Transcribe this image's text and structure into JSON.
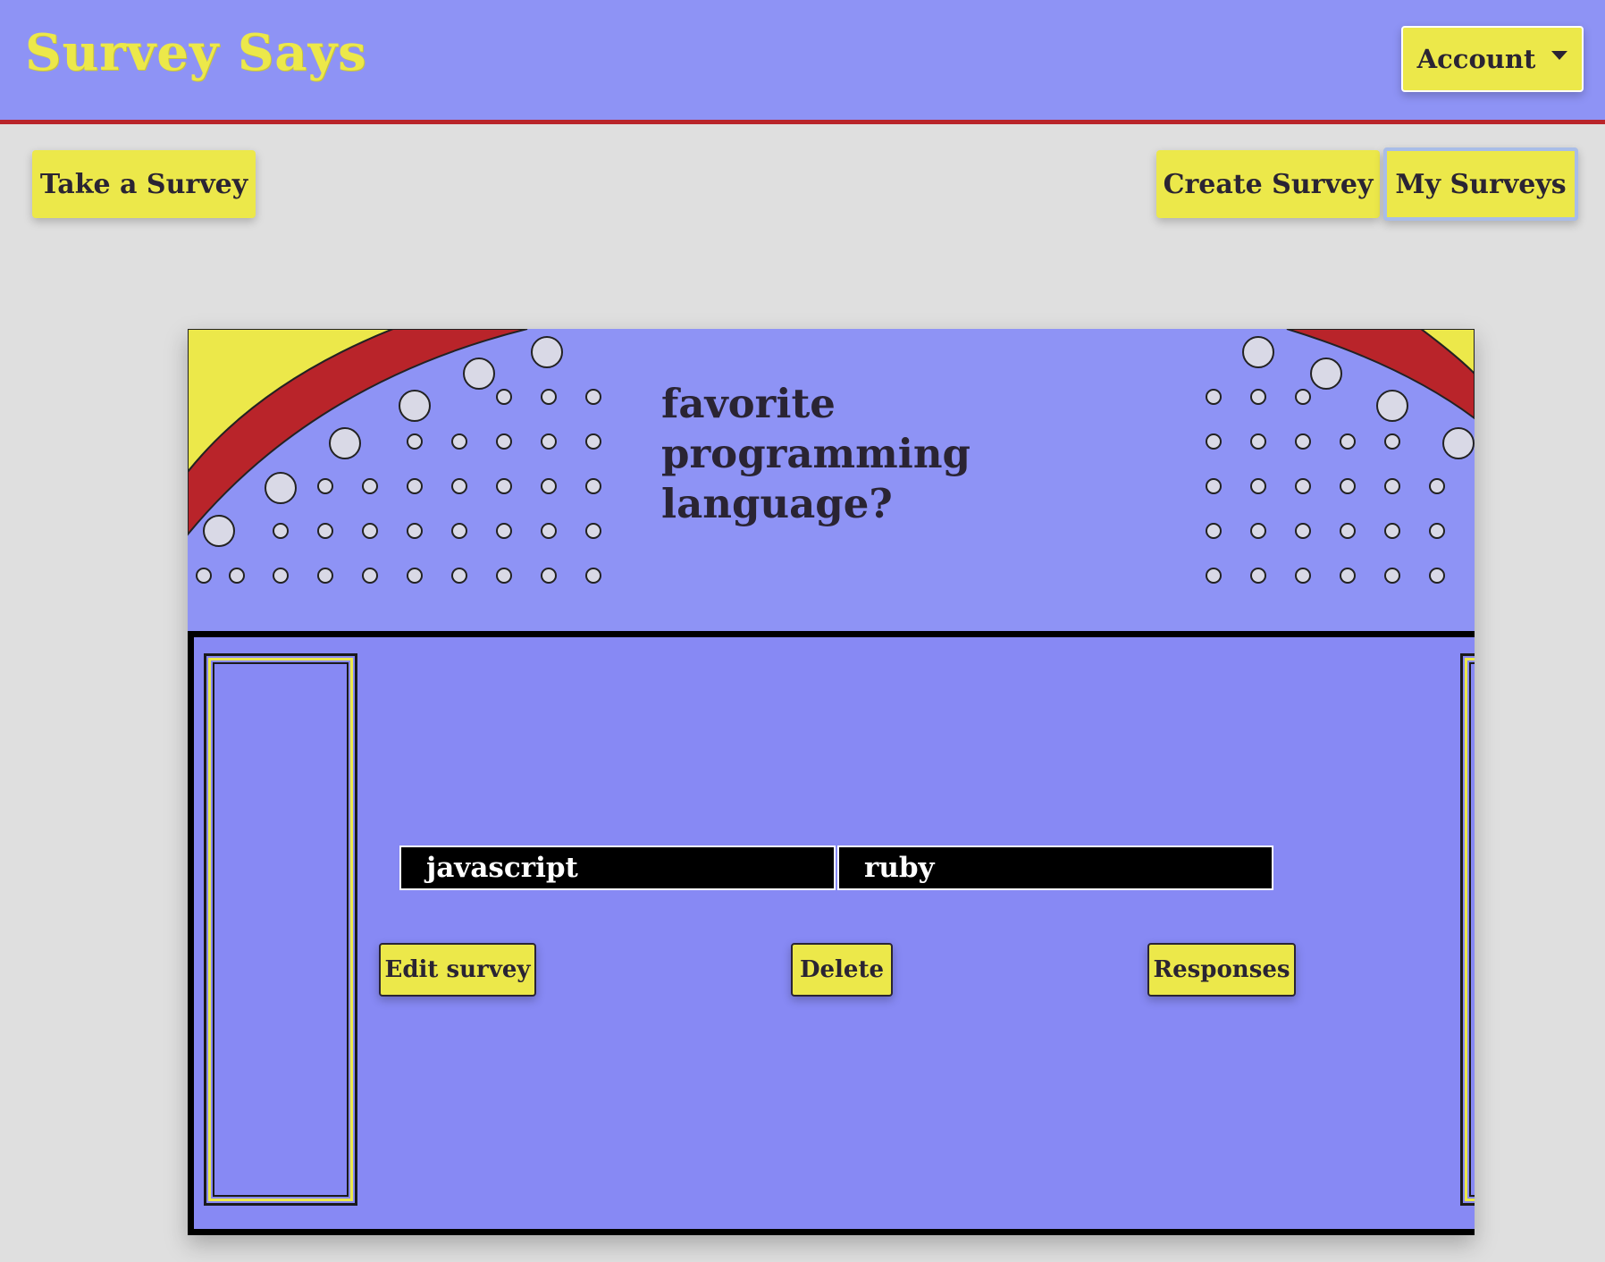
{
  "navbar": {
    "brand": "Survey Says",
    "account_label": "Account"
  },
  "toolbar": {
    "take_survey_label": "Take a Survey",
    "create_survey_label": "Create Survey",
    "my_surveys_label": "My Surveys"
  },
  "survey": {
    "title": "favorite programming language?",
    "answers": [
      "javascript",
      "ruby"
    ],
    "edit_label": "Edit survey",
    "delete_label": "Delete",
    "responses_label": "Responses"
  },
  "colors": {
    "navbar_bg": "#8e93f5",
    "accent_yellow": "#ece84a",
    "navbar_border_red": "#b9242a",
    "page_bg": "#dfdfdf",
    "board_bg": "#8789f4",
    "answer_bg": "#000000",
    "answer_text": "#ffffff"
  },
  "icons": {
    "account_dropdown": "caret-down-icon"
  }
}
